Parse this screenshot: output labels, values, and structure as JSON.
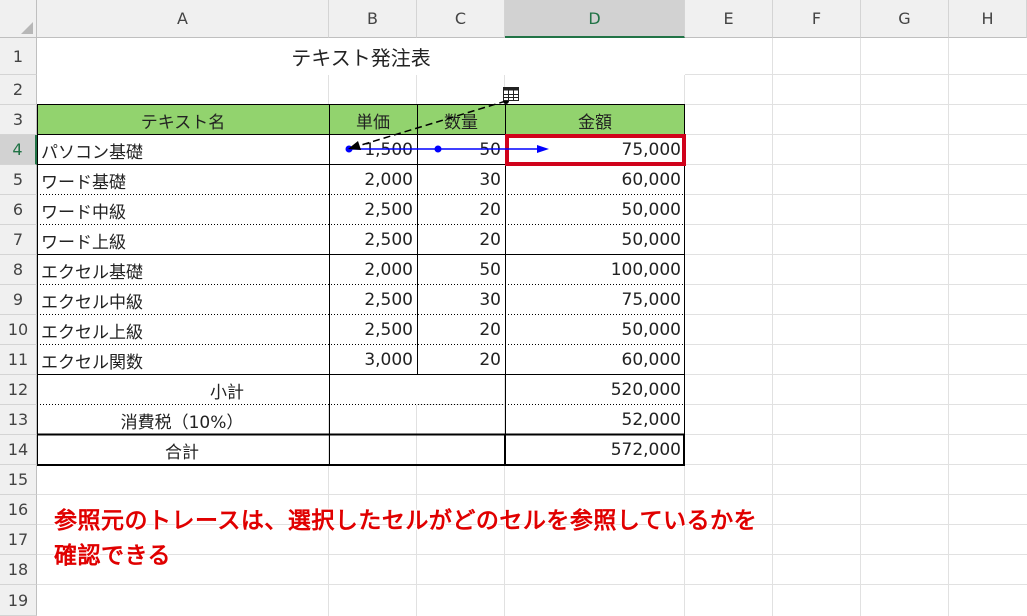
{
  "columns": [
    "A",
    "B",
    "C",
    "D",
    "E",
    "F",
    "G",
    "H"
  ],
  "rows": [
    "1",
    "2",
    "3",
    "4",
    "5",
    "6",
    "7",
    "8",
    "9",
    "10",
    "11",
    "12",
    "13",
    "14",
    "15",
    "16",
    "17",
    "18",
    "19"
  ],
  "title": "テキスト発注表",
  "headers": {
    "name": "テキスト名",
    "price": "単価",
    "qty": "数量",
    "amount": "金額"
  },
  "items": [
    {
      "name": "パソコン基礎",
      "price": "1,500",
      "qty": "50",
      "amount": "75,000"
    },
    {
      "name": "ワード基礎",
      "price": "2,000",
      "qty": "30",
      "amount": "60,000"
    },
    {
      "name": "ワード中級",
      "price": "2,500",
      "qty": "20",
      "amount": "50,000"
    },
    {
      "name": "ワード上級",
      "price": "2,500",
      "qty": "20",
      "amount": "50,000"
    },
    {
      "name": "エクセル基礎",
      "price": "2,000",
      "qty": "50",
      "amount": "100,000"
    },
    {
      "name": "エクセル中級",
      "price": "2,500",
      "qty": "30",
      "amount": "75,000"
    },
    {
      "name": "エクセル上級",
      "price": "2,500",
      "qty": "20",
      "amount": "50,000"
    },
    {
      "name": "エクセル関数",
      "price": "3,000",
      "qty": "20",
      "amount": "60,000"
    }
  ],
  "totals": {
    "subtotal_label": "小計",
    "subtotal": "520,000",
    "tax_label": "消費税（10%）",
    "tax": "52,000",
    "total_label": "合計",
    "total": "572,000"
  },
  "note": {
    "line1": "参照元のトレースは、選択したセルがどのセルを参照しているかを",
    "line2": "確認できる"
  },
  "colors": {
    "header_fill": "#92d36e",
    "highlight": "#d0021b",
    "trace_arrow": "#0000ff",
    "note_text": "#e00000",
    "select_accent": "#217346"
  },
  "selected_cell": "D4",
  "icons": [
    "worksheet-reference-icon"
  ]
}
